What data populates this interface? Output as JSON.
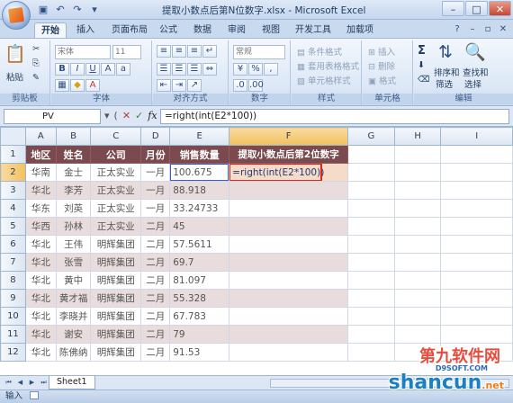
{
  "window": {
    "title": "提取小数点后第N位数字.xlsx - Microsoft Excel"
  },
  "tabs": [
    "开始",
    "插入",
    "页面布局",
    "公式",
    "数据",
    "审阅",
    "视图",
    "开发工具",
    "加载项"
  ],
  "ribbon": {
    "clipboard": {
      "paste": "粘贴",
      "label": "剪贴板"
    },
    "font": {
      "name": "宋体",
      "size": "11",
      "label": "字体"
    },
    "alignment": {
      "label": "对齐方式"
    },
    "number": {
      "format": "常规",
      "label": "数字"
    },
    "styles": {
      "conditional": "条件格式",
      "table": "套用表格格式",
      "cell": "单元格样式",
      "label": "样式"
    },
    "cells": {
      "insert": "插入",
      "delete": "删除",
      "format": "格式",
      "label": "单元格"
    },
    "editing": {
      "sum": "Σ",
      "sort": "排序和",
      "filter": "筛选",
      "find": "查找和",
      "select": "选择",
      "label": "编辑"
    }
  },
  "formula_bar": {
    "name_box": "PV",
    "formula": "=right(int(E2*100))"
  },
  "grid": {
    "columns": [
      "A",
      "B",
      "C",
      "D",
      "E",
      "F",
      "G",
      "H",
      "I"
    ],
    "headers": [
      "地区",
      "姓名",
      "公司",
      "月份",
      "销售数量",
      "提取小数点后第2位数字"
    ],
    "rows": [
      [
        "华南",
        "金士",
        "正太实业",
        "一月",
        "100.675",
        "=right(int(E2*100))"
      ],
      [
        "华北",
        "李芳",
        "正太实业",
        "一月",
        "88.918",
        ""
      ],
      [
        "华东",
        "刘英",
        "正太实业",
        "一月",
        "33.24733",
        ""
      ],
      [
        "华西",
        "孙林",
        "正太实业",
        "二月",
        "45",
        ""
      ],
      [
        "华北",
        "王伟",
        "明辉集团",
        "二月",
        "57.5611",
        ""
      ],
      [
        "华北",
        "张雪",
        "明辉集团",
        "二月",
        "69.7",
        ""
      ],
      [
        "华北",
        "黄中",
        "明辉集团",
        "二月",
        "81.097",
        ""
      ],
      [
        "华北",
        "黄才福",
        "明辉集团",
        "二月",
        "55.328",
        ""
      ],
      [
        "华北",
        "李晓并",
        "明辉集团",
        "二月",
        "67.783",
        ""
      ],
      [
        "华北",
        "谢安",
        "明辉集团",
        "二月",
        "79",
        ""
      ],
      [
        "华北",
        "陈佛纳",
        "明辉集团",
        "二月",
        "91.53",
        ""
      ]
    ]
  },
  "sheet_tab": "Sheet1",
  "status": "输入",
  "watermark": {
    "top": "第九软件网",
    "domain": "D9SOFT.COM",
    "bottom": "shancun",
    "bottom_tld": ".net"
  }
}
